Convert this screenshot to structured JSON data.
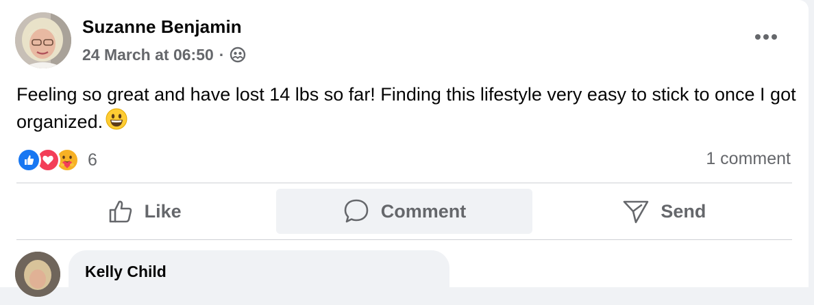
{
  "post": {
    "author": "Suzanne Benjamin",
    "timestamp": "24 March at 06:50",
    "separator": "·",
    "audience_icon": "friends-group-icon",
    "more_icon": "more-horizontal-icon",
    "body": "Feeling so great and have lost 14 lbs so far!  Finding this lifestyle very easy to stick to once I got organized.",
    "body_emoji": "grinning-face-emoji"
  },
  "reactions": {
    "types": [
      "like-icon",
      "love-icon",
      "care-icon"
    ],
    "count": "6",
    "comments": "1 comment"
  },
  "actions": [
    {
      "label": "Like",
      "icon": "thumbs-up-icon"
    },
    {
      "label": "Comment",
      "icon": "comment-bubble-icon"
    },
    {
      "label": "Send",
      "icon": "send-icon"
    }
  ],
  "first_comment": {
    "author": "Kelly Child"
  },
  "colors": {
    "like_blue": "#1877f2",
    "love_red": "#f33e58",
    "care_yellow": "#f7b125",
    "secondary_text": "#65676b",
    "primary_text": "#050505"
  }
}
